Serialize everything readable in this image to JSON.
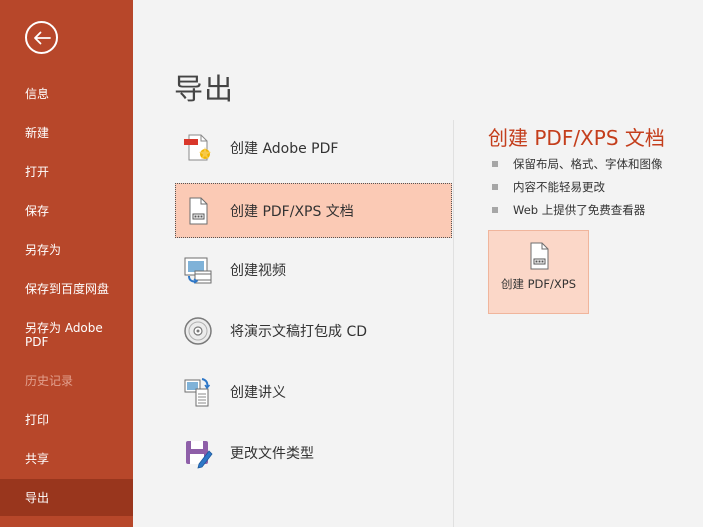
{
  "sidebar": {
    "items": [
      {
        "label": "信息"
      },
      {
        "label": "新建"
      },
      {
        "label": "打开"
      },
      {
        "label": "保存"
      },
      {
        "label": "另存为"
      },
      {
        "label": "保存到百度网盘"
      },
      {
        "label": "另存为 Adobe\nPDF"
      },
      {
        "label": "历史记录",
        "state": "disabled"
      },
      {
        "label": "打印"
      },
      {
        "label": "共享"
      },
      {
        "label": "导出",
        "state": "active"
      }
    ]
  },
  "main": {
    "title": "导出",
    "options": [
      {
        "label": "创建 Adobe PDF",
        "icon": "adobe-pdf-icon"
      },
      {
        "label": "创建 PDF/XPS 文档",
        "icon": "pdf-xps-document-icon",
        "state": "selected"
      },
      {
        "label": "创建视频",
        "icon": "video-icon"
      },
      {
        "label": "将演示文稿打包成 CD",
        "icon": "cd-icon"
      },
      {
        "label": "创建讲义",
        "icon": "handout-icon"
      },
      {
        "label": "更改文件类型",
        "icon": "file-type-icon"
      }
    ]
  },
  "detail": {
    "title": "创建 PDF/XPS 文档",
    "bullets": [
      "保留布局、格式、字体和图像",
      "内容不能轻易更改",
      "Web 上提供了免费查看器"
    ],
    "button_label": "创建 PDF/XPS"
  },
  "colors": {
    "sidebar_bg": "#b7472a",
    "sidebar_active": "#99361d",
    "accent_title": "#c43e1c",
    "selected_bg": "#fbcab5"
  }
}
